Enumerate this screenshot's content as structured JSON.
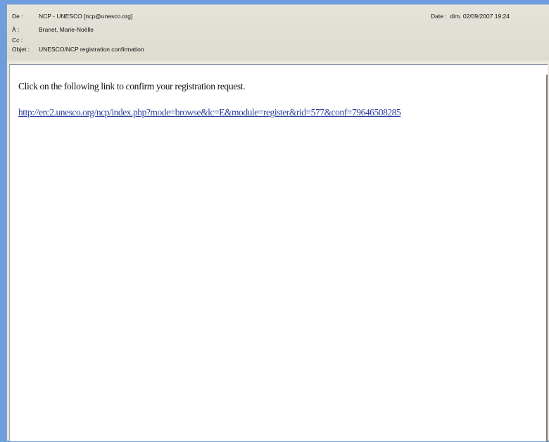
{
  "header": {
    "from_label": "De :",
    "from_value": "NCP - UNESCO [ncp@unesco.org]",
    "to_label": "À :",
    "to_value": "Branet, Marie-Noëlle",
    "cc_label": "Cc :",
    "cc_value": "",
    "subject_label": "Objet :",
    "subject_value": "UNESCO/NCP registration confirmation",
    "date_label": "Date :",
    "date_value": "dim. 02/09/2007 19:24"
  },
  "body": {
    "text": "Click on the following link to confirm your registration request.",
    "link": "http://erc2.unesco.org/ncp/index.php?mode=browse&lc=E&module=register&rid=577&conf=79646508285"
  }
}
